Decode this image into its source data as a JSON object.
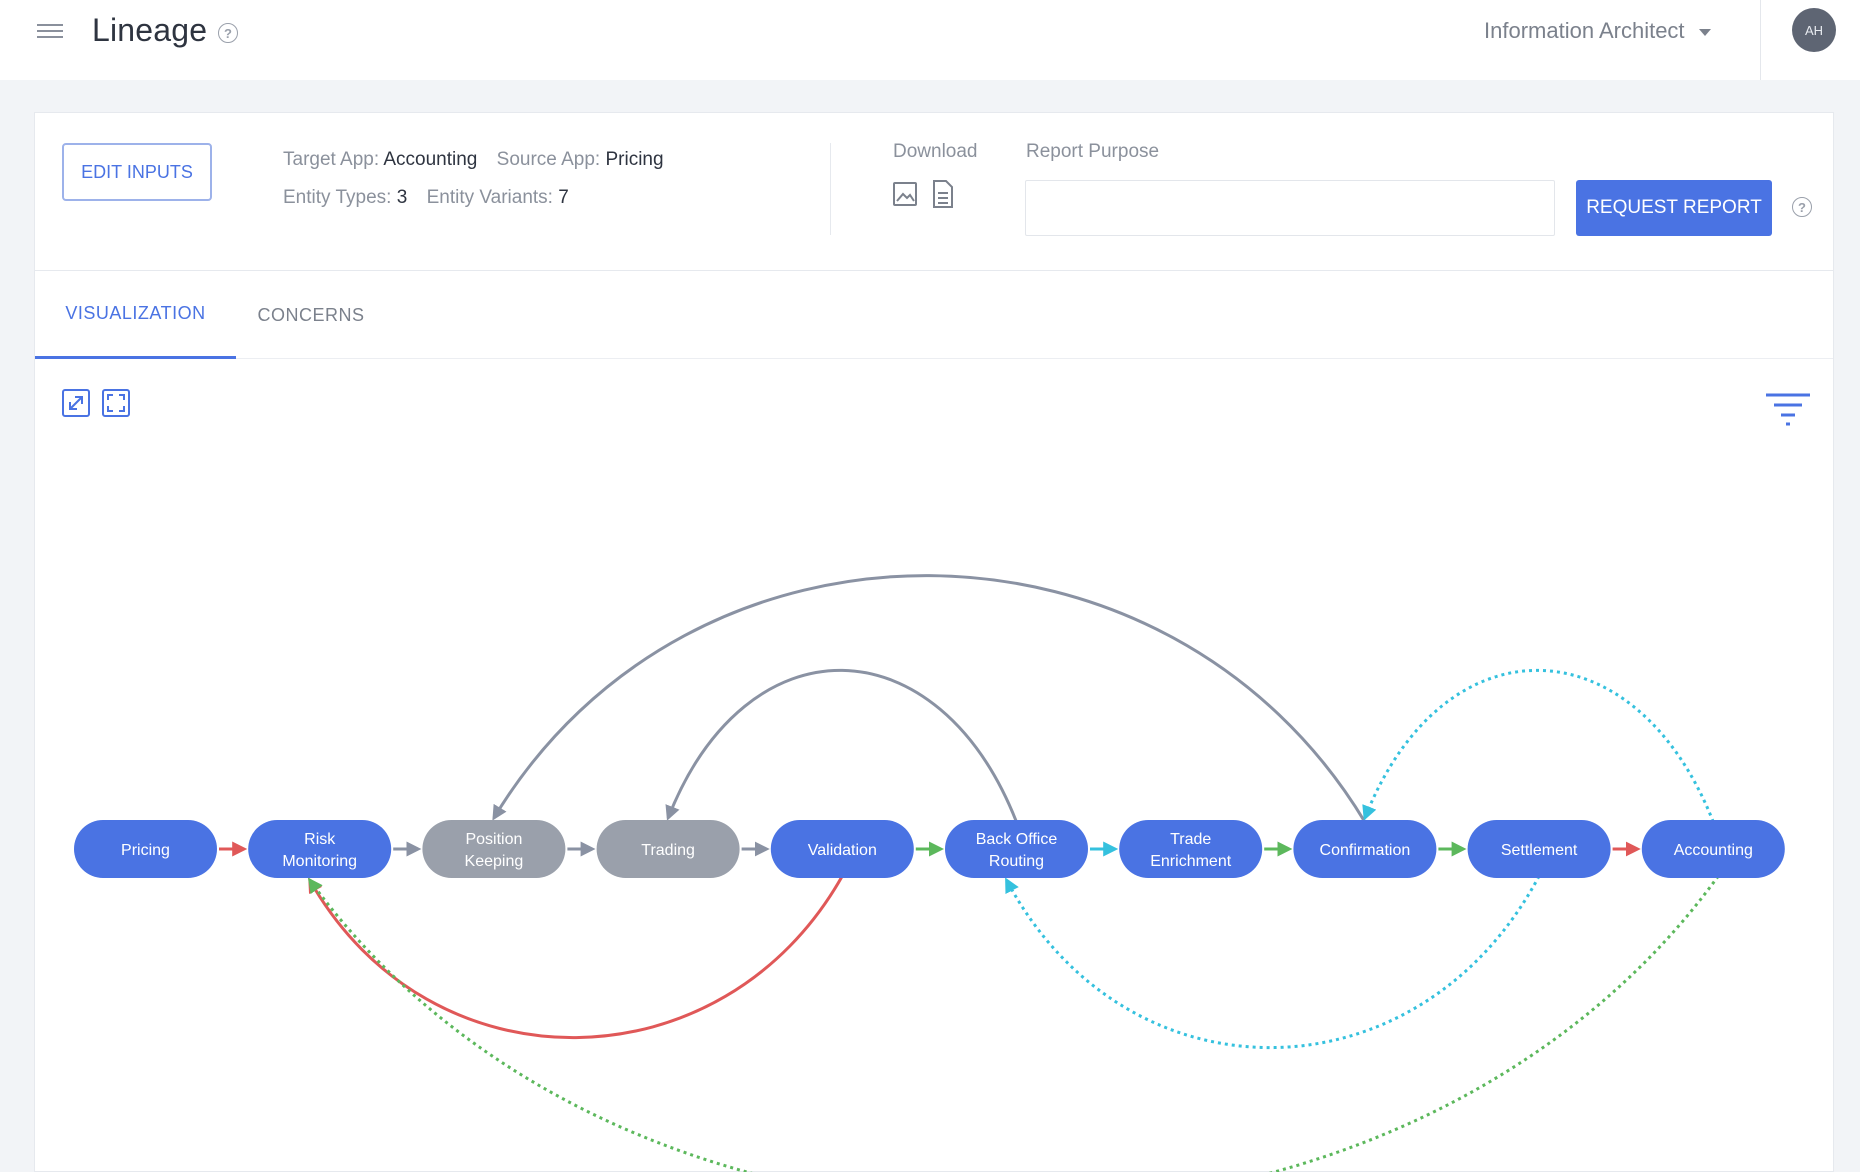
{
  "header": {
    "title": "Lineage",
    "role": "Information Architect",
    "avatar_initials": "AH"
  },
  "inputs": {
    "edit_label": "EDIT INPUTS",
    "target_app_label": "Target App:",
    "target_app": "Accounting",
    "source_app_label": "Source App:",
    "source_app": "Pricing",
    "entity_types_label": "Entity Types:",
    "entity_types": "3",
    "entity_variants_label": "Entity Variants:",
    "entity_variants": "7"
  },
  "download": {
    "label": "Download",
    "icons": [
      "image-download-icon",
      "document-download-icon"
    ]
  },
  "report": {
    "purpose_label": "Report Purpose",
    "purpose_value": "",
    "request_label": "REQUEST REPORT"
  },
  "tabs": [
    {
      "label": "VISUALIZATION",
      "active": true
    },
    {
      "label": "CONCERNS",
      "active": false
    }
  ],
  "toolbar_icons": [
    "expand-icon",
    "fit-to-screen-icon",
    "filter-icon"
  ],
  "colors": {
    "accent": "#4a73e3",
    "node_active": "#4a73e3",
    "node_inactive": "#9aa0ab",
    "edge_red": "#e05858",
    "edge_grey": "#8a92a3",
    "edge_green": "#5cb85c",
    "edge_cyan": "#35c1de"
  },
  "graph": {
    "nodes": [
      {
        "id": "pricing",
        "lines": [
          "Pricing"
        ],
        "active": true
      },
      {
        "id": "risk",
        "lines": [
          "Risk",
          "Monitoring"
        ],
        "active": true
      },
      {
        "id": "position",
        "lines": [
          "Position",
          "Keeping"
        ],
        "active": false
      },
      {
        "id": "trading",
        "lines": [
          "Trading"
        ],
        "active": false
      },
      {
        "id": "validation",
        "lines": [
          "Validation"
        ],
        "active": true
      },
      {
        "id": "backoffice",
        "lines": [
          "Back Office",
          "Routing"
        ],
        "active": true
      },
      {
        "id": "enrichment",
        "lines": [
          "Trade",
          "Enrichment"
        ],
        "active": true
      },
      {
        "id": "confirmation",
        "lines": [
          "Confirmation"
        ],
        "active": true
      },
      {
        "id": "settlement",
        "lines": [
          "Settlement"
        ],
        "active": true
      },
      {
        "id": "accounting",
        "lines": [
          "Accounting"
        ],
        "active": true
      }
    ],
    "edges": [
      {
        "from": "pricing",
        "to": "risk",
        "color": "edge_red",
        "style": "solid"
      },
      {
        "from": "risk",
        "to": "position",
        "color": "edge_grey",
        "style": "solid"
      },
      {
        "from": "position",
        "to": "trading",
        "color": "edge_grey",
        "style": "solid"
      },
      {
        "from": "trading",
        "to": "validation",
        "color": "edge_grey",
        "style": "solid"
      },
      {
        "from": "validation",
        "to": "backoffice",
        "color": "edge_green",
        "style": "solid"
      },
      {
        "from": "backoffice",
        "to": "enrichment",
        "color": "edge_cyan",
        "style": "solid"
      },
      {
        "from": "enrichment",
        "to": "confirmation",
        "color": "edge_green",
        "style": "solid"
      },
      {
        "from": "confirmation",
        "to": "settlement",
        "color": "edge_green",
        "style": "solid"
      },
      {
        "from": "settlement",
        "to": "accounting",
        "color": "edge_red",
        "style": "solid"
      },
      {
        "from": "confirmation",
        "to": "position",
        "color": "edge_grey",
        "style": "solid"
      },
      {
        "from": "backoffice",
        "to": "trading",
        "color": "edge_grey",
        "style": "solid"
      },
      {
        "from": "validation",
        "to": "risk",
        "color": "edge_red",
        "style": "solid"
      },
      {
        "from": "accounting",
        "to": "confirmation",
        "color": "edge_cyan",
        "style": "dotted"
      },
      {
        "from": "settlement",
        "to": "backoffice",
        "color": "edge_cyan",
        "style": "dotted"
      },
      {
        "from": "accounting",
        "to": "risk",
        "color": "edge_green",
        "style": "dotted"
      }
    ]
  }
}
